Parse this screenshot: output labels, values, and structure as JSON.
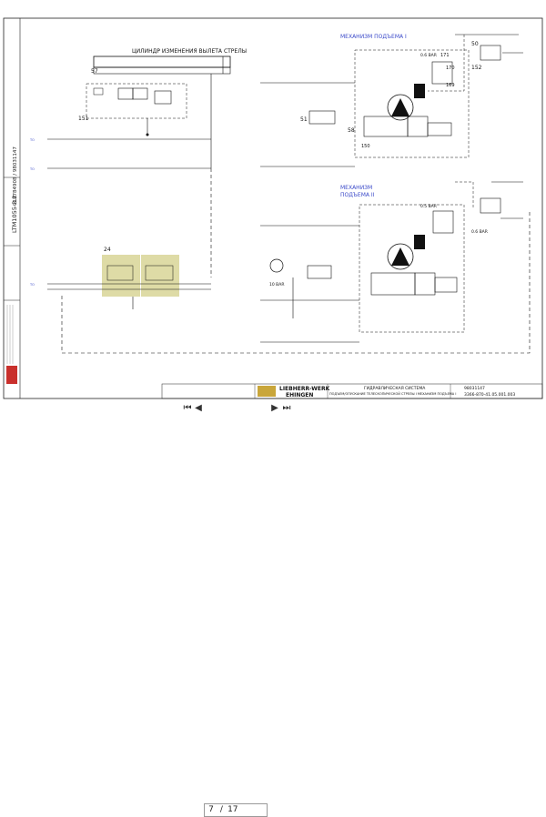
{
  "drawing": {
    "vertical_title": "LTM1055-3.2",
    "vertical_number": "918784908 / 98031147",
    "cylinder_title": "ЦИЛИНДР ИЗМЕНЕНИЯ ВЫЛЕТА СТРЕЛЫ",
    "hoist1_title": "МЕХАНИЗМ ПОДЪЕМА I",
    "hoist2_title_line1": "МЕХАНИЗМ",
    "hoist2_title_line2": "ПОДЪЕМА II",
    "labels": {
      "n57": "57",
      "n151": "151",
      "n24": "24",
      "n51": "51",
      "n58": "58",
      "n150": "150",
      "n50": "50",
      "n152": "152",
      "n171": "171",
      "n170": "170",
      "n169": "169"
    },
    "pressures": {
      "p1": "0.6 BAR",
      "p2": "0.5 BAR",
      "p3": "10 BAR",
      "p4": "10 BAR",
      "p5": "0.6 BAR"
    }
  },
  "title_block": {
    "company_line1": "LIEBHERR-WERK",
    "company_line2": "EHINGEN",
    "system_title": "ГИДРАВЛИЧЕСКАЯ СИСТЕМА",
    "system_subtitle": "ПОДЪЕМ/ОПУСКАНИЕ ТЕЛЕСКОПИЧЕСКОЙ СТРЕЛЫ I МЕХАНИЗМ ПОДЪЕМА I",
    "drawing_number": "98031147",
    "doc_number": "3366-870-41.05.001.003"
  },
  "viewer": {
    "current_page": "7",
    "separator": "/",
    "total_pages": "17"
  },
  "colors": {
    "line": "#1a1a1a",
    "flow_line": "#3a49c9",
    "highlight": "#dad79c"
  }
}
